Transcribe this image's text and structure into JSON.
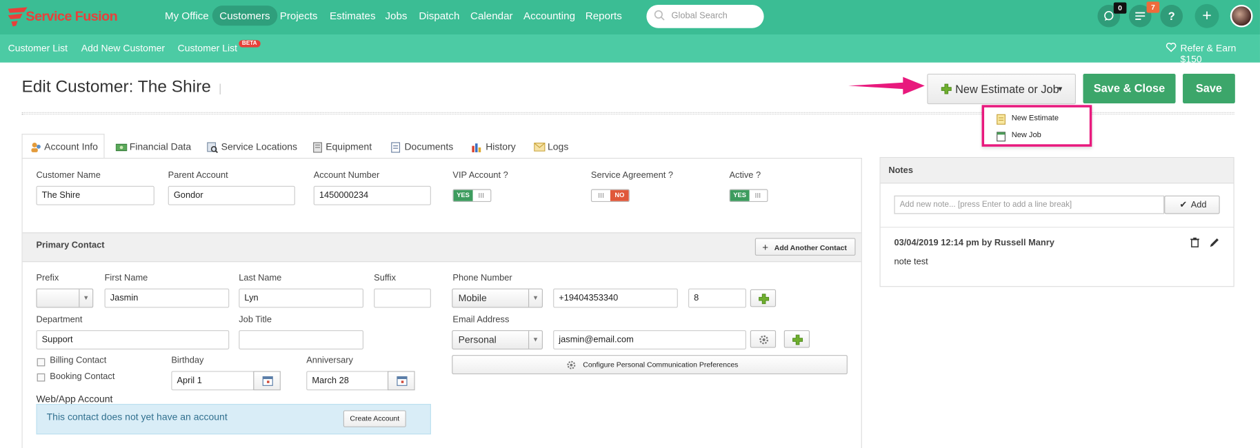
{
  "brand": {
    "name": "Service Fusion"
  },
  "nav": {
    "items": [
      "My Office",
      "Customers",
      "Projects",
      "Estimates",
      "Jobs",
      "Dispatch",
      "Calendar",
      "Accounting",
      "Reports"
    ],
    "active": "Customers"
  },
  "search": {
    "placeholder": "Global Search"
  },
  "badges": {
    "chat": "0",
    "tasks": "7"
  },
  "subnav": {
    "items": [
      "Customer List",
      "Add New Customer",
      "Customer List"
    ],
    "beta": "BETA",
    "refer": "Refer & Earn $150"
  },
  "page": {
    "title": "Edit Customer: The Shire",
    "title_sep": "|"
  },
  "actions": {
    "new_estimate_job": "New Estimate or Job",
    "save_close": "Save & Close",
    "save": "Save"
  },
  "dropdown": {
    "new_estimate": "New Estimate",
    "new_job": "New Job"
  },
  "tabs": [
    "Account Info",
    "Financial Data",
    "Service Locations",
    "Equipment",
    "Documents",
    "History",
    "Logs"
  ],
  "account": {
    "customer_name_label": "Customer Name",
    "customer_name": "The Shire",
    "parent_label": "Parent Account",
    "parent": "Gondor",
    "account_number_label": "Account Number",
    "account_number": "1450000234",
    "vip_label": "VIP Account ?",
    "service_label": "Service Agreement ?",
    "active_label": "Active ?",
    "yes": "YES",
    "no": "NO",
    "grip": "III"
  },
  "contact": {
    "heading": "Primary Contact",
    "add_contact": "Add Another Contact",
    "prefix_label": "Prefix",
    "first_label": "First Name",
    "first": "Jasmin",
    "last_label": "Last Name",
    "last": "Lyn",
    "suffix_label": "Suffix",
    "phone_label": "Phone Number",
    "phone_type": "Mobile",
    "phone": "+19404353340",
    "ext": "8",
    "dept_label": "Department",
    "dept": "Support",
    "jobtitle_label": "Job Title",
    "email_label": "Email Address",
    "email_type": "Personal",
    "email": "jasmin@email.com",
    "billing": "Billing Contact",
    "booking": "Booking Contact",
    "birthday_label": "Birthday",
    "birthday": "April 1",
    "anniv_label": "Anniversary",
    "anniv": "March 28",
    "config": "Configure Personal Communication Preferences",
    "webapp_label": "Web/App Account",
    "no_account": "This contact does not yet have an account",
    "create": "Create Account"
  },
  "notes": {
    "heading": "Notes",
    "placeholder": "Add new note... [press Enter to add a line break]",
    "add": "Add",
    "entry_meta": "03/04/2019 12:14 pm by Russell Manry",
    "entry_text": "note test"
  },
  "colors": {
    "topbar": "#3bbd94",
    "subbar": "#4ccba4",
    "save": "#3ca66a",
    "highlight": "#e8197d"
  }
}
